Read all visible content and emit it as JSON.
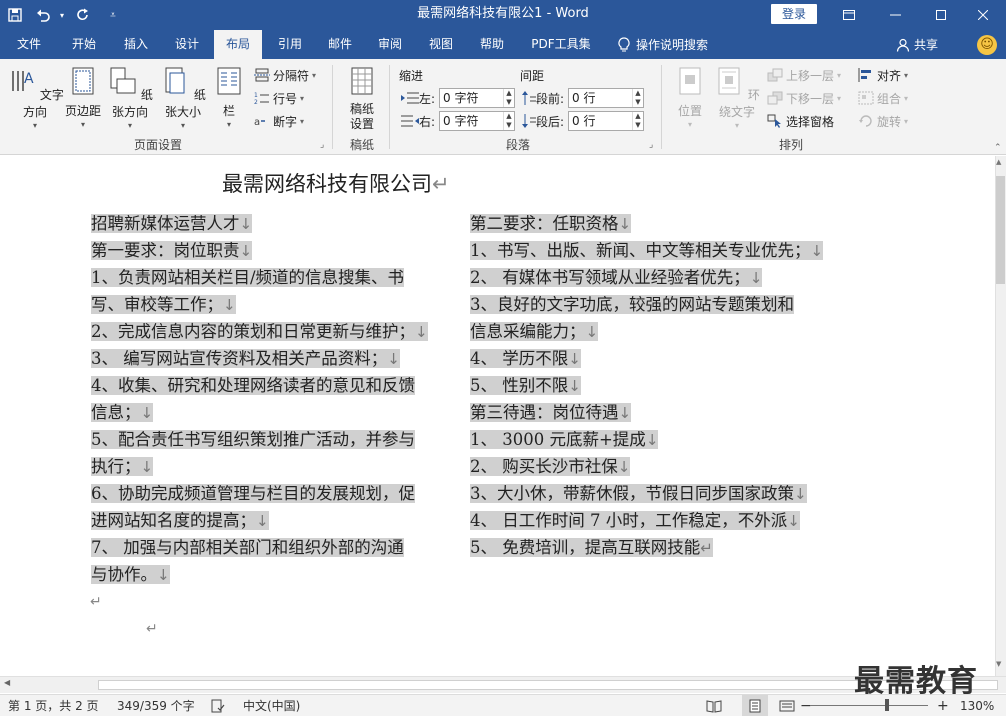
{
  "app": {
    "window_title": "最需网络科技有限公1  -  Word",
    "login_label": "登录"
  },
  "tabs": [
    "文件",
    "开始",
    "插入",
    "设计",
    "布局",
    "引用",
    "邮件",
    "审阅",
    "视图",
    "帮助",
    "PDF工具集"
  ],
  "active_tab": "布局",
  "tell_me": "操作说明搜索",
  "share": "共享",
  "ribbon": {
    "page_setup": {
      "label": "页面设置",
      "text_direction": "文字方向",
      "margins": "页边距",
      "orientation": "纸张方向",
      "size": "纸张大小",
      "columns": "栏",
      "breaks": "分隔符",
      "line_numbers": "行号",
      "hyphenation": "断字"
    },
    "manuscript": {
      "label": "稿纸",
      "button": "稿纸\n设置"
    },
    "paragraph": {
      "label": "段落",
      "indent_title": "缩进",
      "spacing_title": "间距",
      "left_label": "左:",
      "left_value": "0 字符",
      "right_label": "右:",
      "right_value": "0 字符",
      "before_label": "段前:",
      "before_value": "0 行",
      "after_label": "段后:",
      "after_value": "0 行"
    },
    "arrange": {
      "label": "排列",
      "position": "位置",
      "wrap_text": "环绕文字",
      "bring_forward": "上移一层",
      "send_backward": "下移一层",
      "selection_pane": "选择窗格",
      "align": "对齐",
      "group": "组合",
      "rotate": "旋转"
    }
  },
  "document": {
    "title": "最需网络科技有限公司",
    "title_underlined": "网络",
    "left_column": [
      "招聘新媒体运营人才",
      "第一要求：岗位职责",
      "1、负责网站相关栏目/频道的信息搜集、书",
      "写、审校等工作；",
      "2、完成信息内容的策划和日常更新与维护；",
      "3、 编写网站宣传资料及相关产品资料；",
      "4、收集、研究和处理网络读者的意见和反馈",
      "信息；",
      "5、配合责任书写组织策划推广活动，并参与",
      "执行；",
      "6、协助完成频道管理与栏目的发展规划，促",
      "进网站知名度的提高；",
      "7、 加强与内部相关部门和组织外部的沟通",
      "与协作。"
    ],
    "right_column": [
      "第二要求：任职资格",
      "1、书写、出版、新闻、中文等相关专业优先；",
      "2、 有媒体书写领域从业经验者优先；",
      "3、良好的文字功底，较强的网站专题策划和",
      "信息采编能力；",
      "4、 学历不限",
      "5、 性别不限",
      "第三待遇：岗位待遇",
      "1、 3000 元底薪+提成",
      "2、 购买长沙市社保",
      "3、大小休，带薪休假，节假日同步国家政策",
      "4、 日工作时间 7 小时，工作稳定，不外派",
      "5、 免费培训，提高互联网技能"
    ]
  },
  "status": {
    "page": "第 1 页，共 2 页",
    "words": "349/359 个字",
    "language": "中文(中国)",
    "zoom": "130%",
    "zoom_minus": "−",
    "zoom_plus": "+"
  },
  "watermark": "最需教育"
}
